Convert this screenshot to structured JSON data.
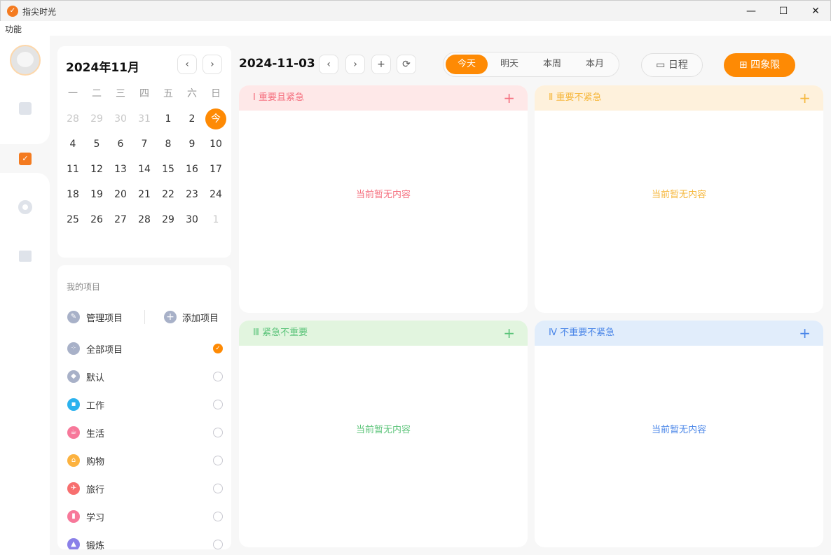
{
  "window": {
    "title": "指尖时光",
    "minimize": "—",
    "maximize": "☐",
    "close": "✕"
  },
  "menu": {
    "function": "功能"
  },
  "calendar": {
    "title": "2024年11月",
    "prev": "‹",
    "next": "›",
    "weekdays": [
      "一",
      "二",
      "三",
      "四",
      "五",
      "六",
      "日"
    ],
    "days": [
      [
        "28",
        "29",
        "30",
        "31",
        "1",
        "2",
        "今"
      ],
      [
        "4",
        "5",
        "6",
        "7",
        "8",
        "9",
        "10"
      ],
      [
        "11",
        "12",
        "13",
        "14",
        "15",
        "16",
        "17"
      ],
      [
        "18",
        "19",
        "20",
        "21",
        "22",
        "23",
        "24"
      ],
      [
        "25",
        "26",
        "27",
        "28",
        "29",
        "30",
        "1"
      ]
    ]
  },
  "projects": {
    "heading": "我的项目",
    "manage": "管理项目",
    "add": "添加项目",
    "items": [
      {
        "label": "全部项目",
        "color": "#a8b1c8",
        "selected": true
      },
      {
        "label": "默认",
        "color": "#a8b1c8"
      },
      {
        "label": "工作",
        "color": "#2bb2ee"
      },
      {
        "label": "生活",
        "color": "#f7789a"
      },
      {
        "label": "购物",
        "color": "#fcb23f"
      },
      {
        "label": "旅行",
        "color": "#f76f6f"
      },
      {
        "label": "学习",
        "color": "#f7789a"
      },
      {
        "label": "锻炼",
        "color": "#8a80e8"
      }
    ]
  },
  "toolbar": {
    "date": "2024-11-03",
    "prev": "‹",
    "next": "›",
    "add": "+",
    "refresh": "⟳",
    "ranges": [
      "今天",
      "明天",
      "本周",
      "本月"
    ],
    "schedule": "日程",
    "quadrant": "四象限"
  },
  "quadrants": [
    {
      "title": "Ⅰ 重要且紧急",
      "empty": "当前暂无内容",
      "color": "#f5707f",
      "bg": "#fee8e8"
    },
    {
      "title": "Ⅱ 重要不紧急",
      "empty": "当前暂无内容",
      "color": "#f6b73c",
      "bg": "#fef1dc"
    },
    {
      "title": "Ⅲ 紧急不重要",
      "empty": "当前暂无内容",
      "color": "#5cc47a",
      "bg": "#e2f5df"
    },
    {
      "title": "Ⅳ 不重要不紧急",
      "empty": "当前暂无内容",
      "color": "#4a86e8",
      "bg": "#e1edfb"
    }
  ],
  "accent": "#fe8a04"
}
